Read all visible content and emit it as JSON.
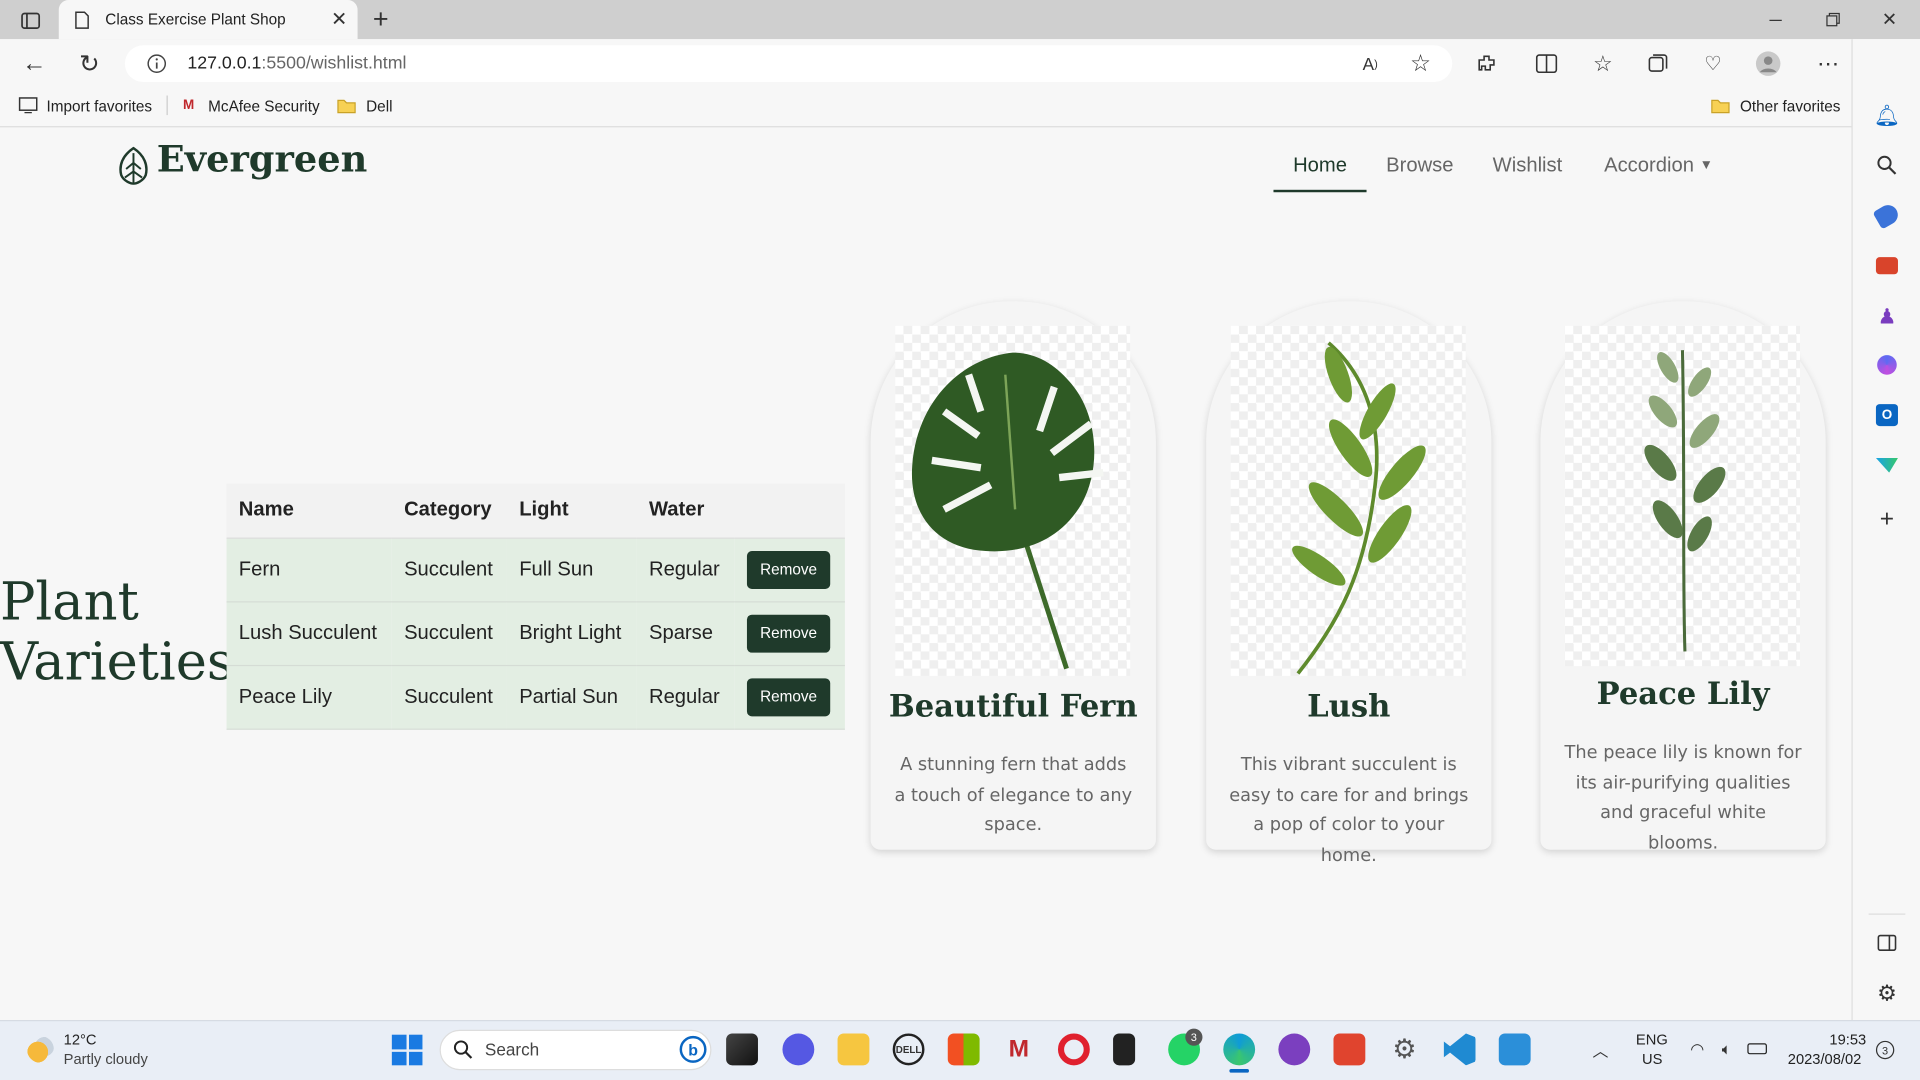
{
  "browser": {
    "tab_title": "Class Exercise Plant Shop",
    "url_host": "127.0.0.1",
    "url_path": ":5500/wishlist.html",
    "favorites": [
      "Import favorites",
      "McAfee Security",
      "Dell"
    ],
    "other_favorites": "Other favorites"
  },
  "site": {
    "logo": "Evergreen",
    "nav": [
      "Home",
      "Browse",
      "Wishlist",
      "Accordion"
    ],
    "heading_line1": "Plant",
    "heading_line2": "Varieties"
  },
  "table": {
    "headers": [
      "Name",
      "Category",
      "Light",
      "Water"
    ],
    "rows": [
      {
        "name": "Fern",
        "category": "Succulent",
        "light": "Full Sun",
        "water": "Regular",
        "action": "Remove"
      },
      {
        "name": "Lush Succulent",
        "category": "Succulent",
        "light": "Bright Light",
        "water": "Sparse",
        "action": "Remove"
      },
      {
        "name": "Peace Lily",
        "category": "Succulent",
        "light": "Partial Sun",
        "water": "Regular",
        "action": "Remove"
      }
    ]
  },
  "cards": [
    {
      "title": "Beautiful Fern",
      "description": "A stunning fern that adds a touch of elegance to any space."
    },
    {
      "title": "Lush",
      "description": "This vibrant succulent is easy to care for and brings a pop of color to your home."
    },
    {
      "title": "Peace Lily",
      "description": "The peace lily is known for its air-purifying qualities and graceful white blooms."
    }
  ],
  "taskbar": {
    "weather_temp": "12°C",
    "weather_desc": "Partly cloudy",
    "search_placeholder": "Search",
    "lang1": "ENG",
    "lang2": "US",
    "time": "19:53",
    "date": "2023/08/02",
    "notif_count": "3",
    "whatsapp_badge": "3"
  },
  "colors": {
    "brand": "#1f3a2b",
    "accent": "#0a66c2"
  }
}
